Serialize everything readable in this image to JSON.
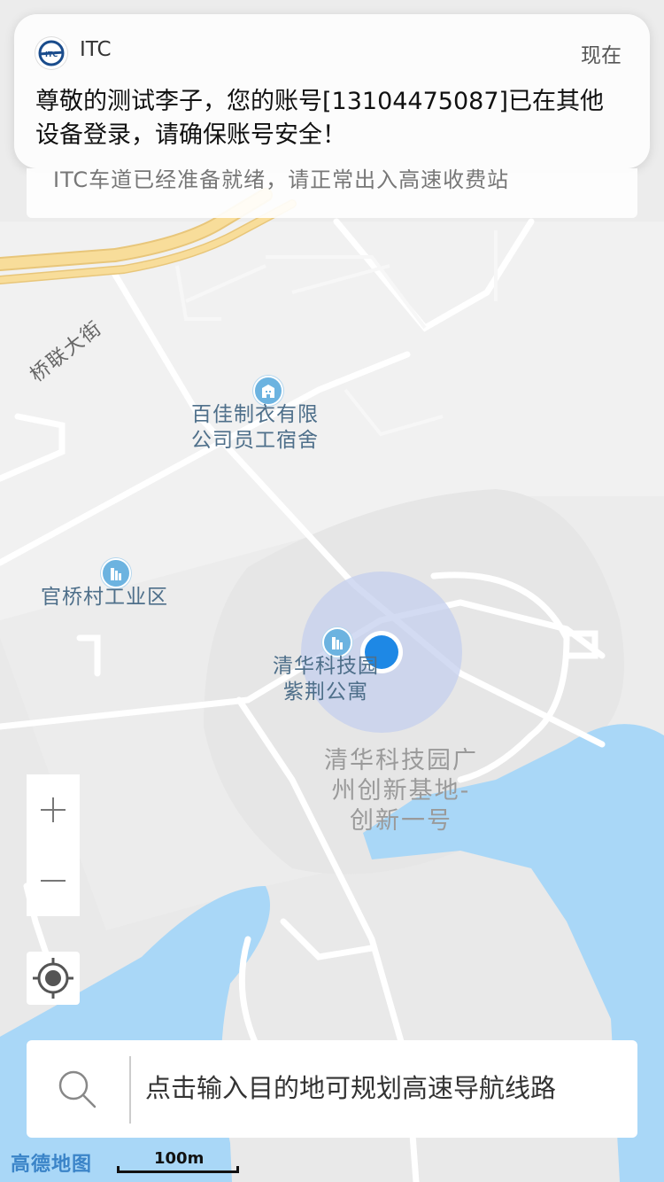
{
  "notification": {
    "app_name": "ITC",
    "time": "现在",
    "message": "尊敬的测试李子，您的账号[13104475087]已在其他设备登录，请确保账号安全！"
  },
  "banner": {
    "text": "ITC车道已经准备就绪，请正常出入高速收费站"
  },
  "map": {
    "road_labels": [
      "桥联大街"
    ],
    "pois": [
      {
        "label": "百佳制衣有限\n公司员工宿舍",
        "icon": "building-icon"
      },
      {
        "label": "官桥村工业区",
        "icon": "building-icon"
      },
      {
        "label": "清华科技园\n紫荆公寓",
        "icon": "building-icon"
      }
    ],
    "area_labels": [
      "清华科技园广\n州创新基地-\n创新一号"
    ],
    "colors": {
      "land": "#ebebeb",
      "water": "#a9d7f7",
      "expressway": "#f7d992",
      "location": "#1e88e5"
    }
  },
  "controls": {
    "zoom_in": "+",
    "zoom_out": "—",
    "locate_icon": "locate-icon"
  },
  "search": {
    "placeholder": "点击输入目的地可规划高速导航线路",
    "icon": "search-icon"
  },
  "footer": {
    "brand": "高德地图",
    "scale": "100m"
  }
}
